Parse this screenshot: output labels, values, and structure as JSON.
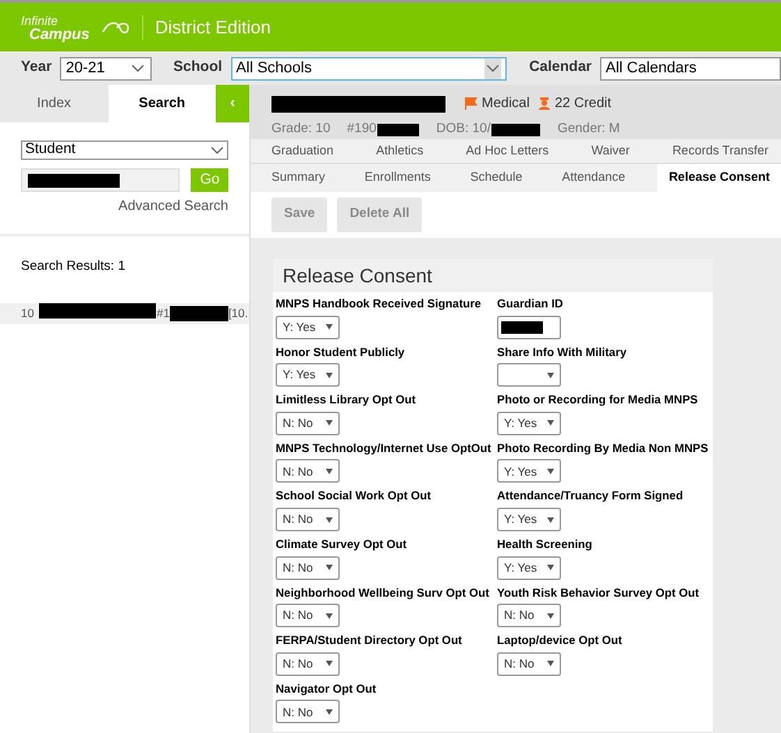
{
  "header": {
    "logo_line1": "Infinite",
    "logo_line2": "Campus",
    "edition": "District Edition"
  },
  "filters": [
    {
      "label": "Year",
      "value": "20-21",
      "focused": false
    },
    {
      "label": "School",
      "value": "All Schools",
      "focused": true
    },
    {
      "label": "Calendar",
      "value": "All Calendars",
      "focused": false
    }
  ],
  "sidebar": {
    "tabs": [
      {
        "label": "Index",
        "selected": false
      },
      {
        "label": "Search",
        "selected": true
      }
    ],
    "collapse": "‹",
    "search_type": "Student",
    "search_value_redacted": true,
    "go": "Go",
    "advanced": "Advanced Search",
    "results": "Search Results: 1",
    "result": {
      "grade": "10",
      "id_prefix": "#1",
      "suffix": "[10."
    }
  },
  "student": {
    "name_redacted": true,
    "flags": [
      {
        "kind": "flag",
        "label": "Medical"
      },
      {
        "kind": "person",
        "label": "22 Credit"
      }
    ],
    "info": [
      {
        "text": "Grade: 10",
        "redacted": false
      },
      {
        "text": "#190",
        "redacted": true
      },
      {
        "text": "DOB: 10/",
        "redacted": true
      },
      {
        "text": "Gender: M",
        "redacted": false
      }
    ]
  },
  "tab_rows": [
    [
      {
        "label": "Graduation",
        "selected": false
      },
      {
        "label": "Athletics",
        "selected": false
      },
      {
        "label": "Ad Hoc Letters",
        "selected": false
      },
      {
        "label": "Waiver",
        "selected": false
      },
      {
        "label": "Records Transfer",
        "selected": false
      }
    ],
    [
      {
        "label": "Summary",
        "selected": false
      },
      {
        "label": "Enrollments",
        "selected": false
      },
      {
        "label": "Schedule",
        "selected": false
      },
      {
        "label": "Attendance",
        "selected": false
      },
      {
        "label": "Release Consent",
        "selected": true
      }
    ]
  ],
  "actions": [
    {
      "label": "Save",
      "disabled": true
    },
    {
      "label": "Delete All",
      "disabled": true
    }
  ],
  "panel": {
    "title": "Release Consent",
    "fields": [
      {
        "label": "MNPS Handbook Received Signature",
        "kind": "select",
        "value": "Y: Yes"
      },
      {
        "label": "Guardian ID",
        "kind": "text",
        "redacted": true
      },
      {
        "label": "Honor Student Publicly",
        "kind": "select",
        "value": "Y: Yes"
      },
      {
        "label": "Share Info With Military",
        "kind": "select"
      },
      {
        "label": "Limitless Library Opt Out",
        "kind": "select",
        "value": "N: No"
      },
      {
        "label": "Photo or Recording for Media MNPS",
        "kind": "select",
        "value": "Y: Yes"
      },
      {
        "label": "MNPS Technology/Internet Use OptOut",
        "kind": "select",
        "value": "N: No"
      },
      {
        "label": "Photo Recording By Media Non MNPS",
        "kind": "select",
        "value": "Y: Yes"
      },
      {
        "label": "School Social Work Opt Out",
        "kind": "select",
        "value": "N: No"
      },
      {
        "label": "Attendance/Truancy Form Signed",
        "kind": "select",
        "value": "Y: Yes"
      },
      {
        "label": "Climate Survey Opt Out",
        "kind": "select",
        "value": "N: No"
      },
      {
        "label": "Health Screening",
        "kind": "select",
        "value": "Y: Yes"
      },
      {
        "label": "Neighborhood Wellbeing Surv Opt Out",
        "kind": "select",
        "value": "N: No"
      },
      {
        "label": "Youth Risk Behavior Survey Opt Out",
        "kind": "select",
        "value": "N: No"
      },
      {
        "label": "FERPA/Student Directory Opt Out",
        "kind": "select",
        "value": "N: No"
      },
      {
        "label": "Laptop/device Opt Out",
        "kind": "select",
        "value": "N: No"
      },
      {
        "label": "Navigator Opt Out",
        "kind": "select",
        "value": "N: No"
      }
    ]
  }
}
